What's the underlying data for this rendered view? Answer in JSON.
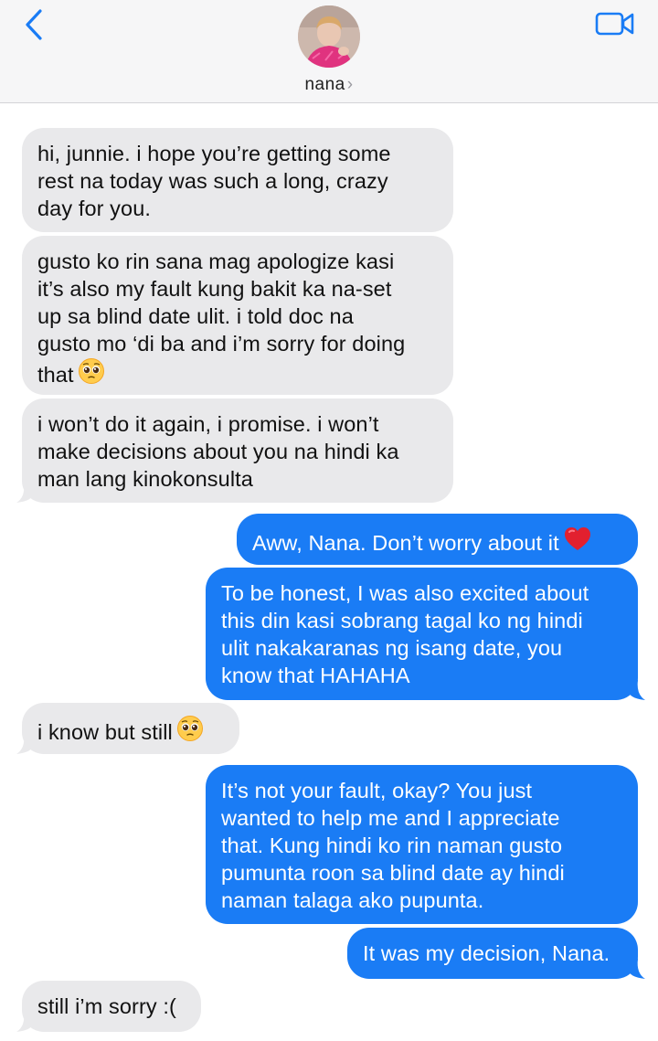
{
  "header": {
    "contact_name": "nana",
    "chevron": "›",
    "icons": {
      "back": "chevron-left-icon",
      "video": "video-camera-icon"
    },
    "accent": "#1a7cf5"
  },
  "messages": [
    {
      "side": "in",
      "lines": [
        "hi, junnie. i hope you’re getting some",
        "rest na today was such a long, crazy",
        "day for you."
      ]
    },
    {
      "side": "in",
      "lines": [
        "gusto ko rin sana mag apologize kasi",
        "it’s also my fault kung bakit ka na-set",
        "up sa blind date ulit. i told doc na",
        "gusto mo ‘di ba and i’m sorry for doing",
        "that"
      ],
      "emoji": "pleading-face"
    },
    {
      "side": "in",
      "lines": [
        "i won’t do it again, i promise. i won’t",
        "make decisions about you na hindi ka",
        "man lang kinokonsulta"
      ]
    },
    {
      "side": "out",
      "lines": [
        "Aww, Nana. Don’t worry about it"
      ],
      "emoji": "red-heart"
    },
    {
      "side": "out",
      "lines": [
        "To be honest, I was also excited about",
        "this din kasi sobrang tagal ko ng hindi",
        "ulit nakakaranas ng isang date, you",
        "know that HAHAHA"
      ]
    },
    {
      "side": "in",
      "lines": [
        "i know but still"
      ],
      "emoji": "pleading-face"
    },
    {
      "side": "out",
      "lines": [
        "It’s not your fault, okay? You just",
        "wanted to help me and I appreciate",
        "that. Kung hindi ko rin naman gusto",
        "pumunta roon sa blind date ay hindi",
        "naman talaga ako pupunta."
      ]
    },
    {
      "side": "out",
      "lines": [
        "It was my decision, Nana."
      ]
    },
    {
      "side": "in",
      "lines": [
        "still i’m sorry :("
      ]
    }
  ]
}
